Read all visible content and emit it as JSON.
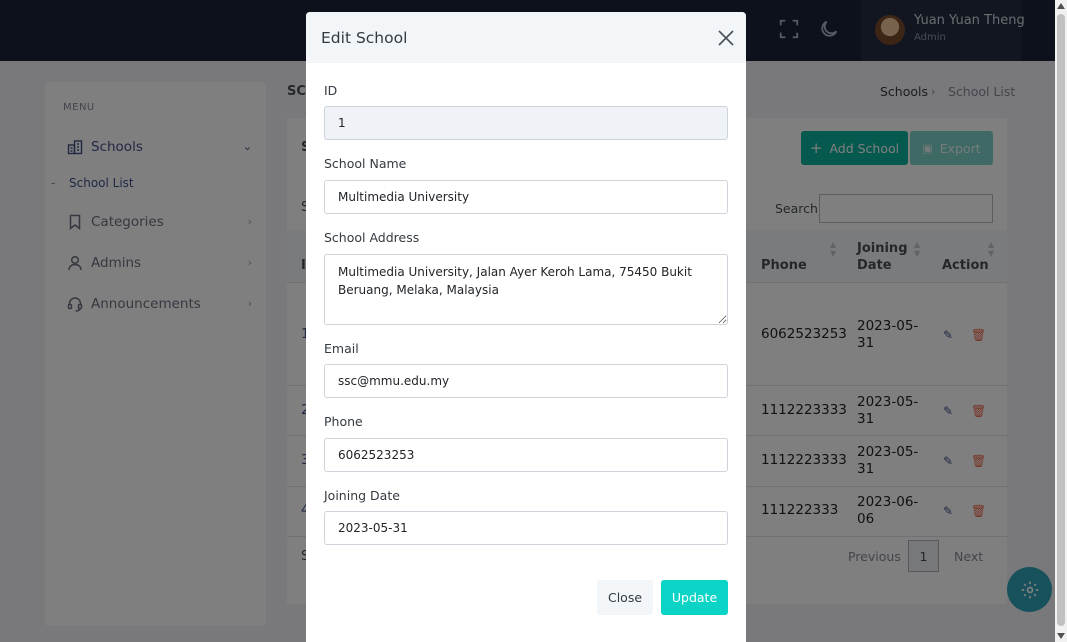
{
  "topbar": {
    "user_name": "Yuan Yuan Theng",
    "user_role": "Admin",
    "icons": [
      "fullscreen-icon",
      "moon-icon"
    ]
  },
  "sidebar": {
    "menu_title": "MENU",
    "items": [
      {
        "label": "Schools",
        "icon": "building-icon",
        "active": true,
        "chevron": "down"
      },
      {
        "label": "Categories",
        "icon": "bookmark-icon",
        "chevron": "right"
      },
      {
        "label": "Admins",
        "icon": "user-icon",
        "chevron": "right"
      },
      {
        "label": "Announcements",
        "icon": "headset-icon",
        "chevron": "right"
      }
    ],
    "sub_item": "School List"
  },
  "page": {
    "heading_partial": "SC",
    "breadcrumb": [
      "Schools",
      "School List"
    ],
    "add_button": "Add School",
    "export_button": "Export",
    "search_label": "Search:",
    "columns": {
      "phone": "Phone",
      "joining_date": "Joining Date",
      "action": "Action"
    },
    "rows": [
      {
        "id": "1",
        "phone": "6062523253",
        "date": "2023-05-31"
      },
      {
        "id": "2",
        "phone": "1112223333",
        "date": "2023-05-31"
      },
      {
        "id": "3",
        "phone": "1112223333",
        "date": "2023-05-31"
      },
      {
        "id": "4",
        "phone": "111222333",
        "date": "2023-06-06"
      }
    ],
    "pagination": {
      "previous": "Previous",
      "page": "1",
      "next": "Next"
    }
  },
  "modal": {
    "title": "Edit School",
    "fields": {
      "id_label": "ID",
      "id_value": "1",
      "name_label": "School Name",
      "name_value": "Multimedia University",
      "address_label": "School Address",
      "address_value": "Multimedia University, Jalan Ayer Keroh Lama, 75450 Bukit Beruang, Melaka, Malaysia",
      "email_label": "Email",
      "email_value": "ssc@mmu.edu.my",
      "phone_label": "Phone",
      "phone_value": "6062523253",
      "date_label": "Joining Date",
      "date_value": "2023-05-31"
    },
    "close_button": "Close",
    "update_button": "Update"
  },
  "colors": {
    "topbar": "#1a2237",
    "primary": "#405189",
    "success": "#0ab39c",
    "update": "#0bd3c5",
    "danger": "#f06548"
  }
}
